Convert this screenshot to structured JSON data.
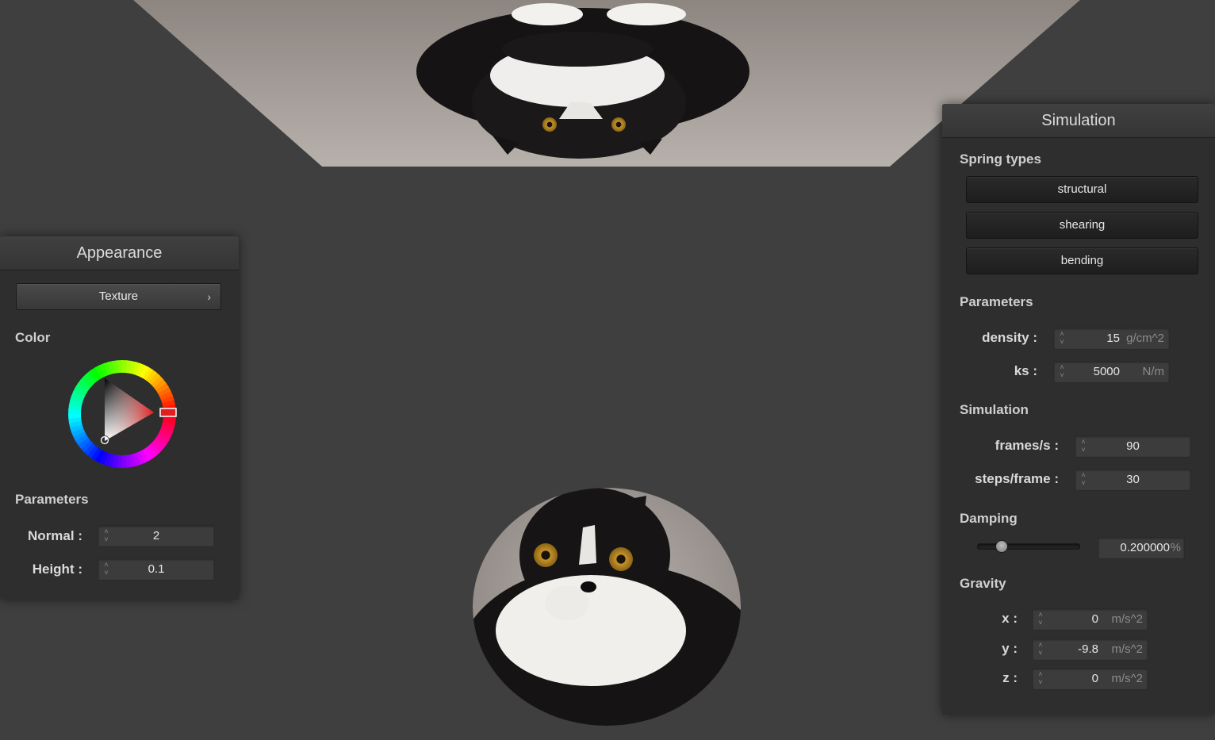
{
  "appearance": {
    "title": "Appearance",
    "texture_button": "Texture",
    "color_label": "Color",
    "color_value": "#e02020",
    "parameters_label": "Parameters",
    "params": [
      {
        "label": "Normal :",
        "value": "2"
      },
      {
        "label": "Height :",
        "value": "0.1"
      }
    ]
  },
  "simulation_panel": {
    "title": "Simulation",
    "spring_types_label": "Spring types",
    "spring_types": [
      "structural",
      "shearing",
      "bending"
    ],
    "parameters_label": "Parameters",
    "density": {
      "label": "density :",
      "value": "15",
      "unit": "g/cm^2"
    },
    "ks": {
      "label": "ks :",
      "value": "5000",
      "unit": "N/m"
    },
    "simulation_label": "Simulation",
    "frames": {
      "label": "frames/s :",
      "value": "90"
    },
    "steps": {
      "label": "steps/frame :",
      "value": "30"
    },
    "damping_label": "Damping",
    "damping": {
      "value": "0.200000",
      "unit": "%",
      "slider_fraction": 0.2
    },
    "gravity_label": "Gravity",
    "gravity": [
      {
        "label": "x :",
        "value": "0",
        "unit": "m/s^2"
      },
      {
        "label": "y :",
        "value": "-9.8",
        "unit": "m/s^2"
      },
      {
        "label": "z :",
        "value": "0",
        "unit": "m/s^2"
      }
    ]
  },
  "colors": {
    "background": "#3f3f3f",
    "panel": "#2e2e2e",
    "accent_red": "#e02020"
  }
}
